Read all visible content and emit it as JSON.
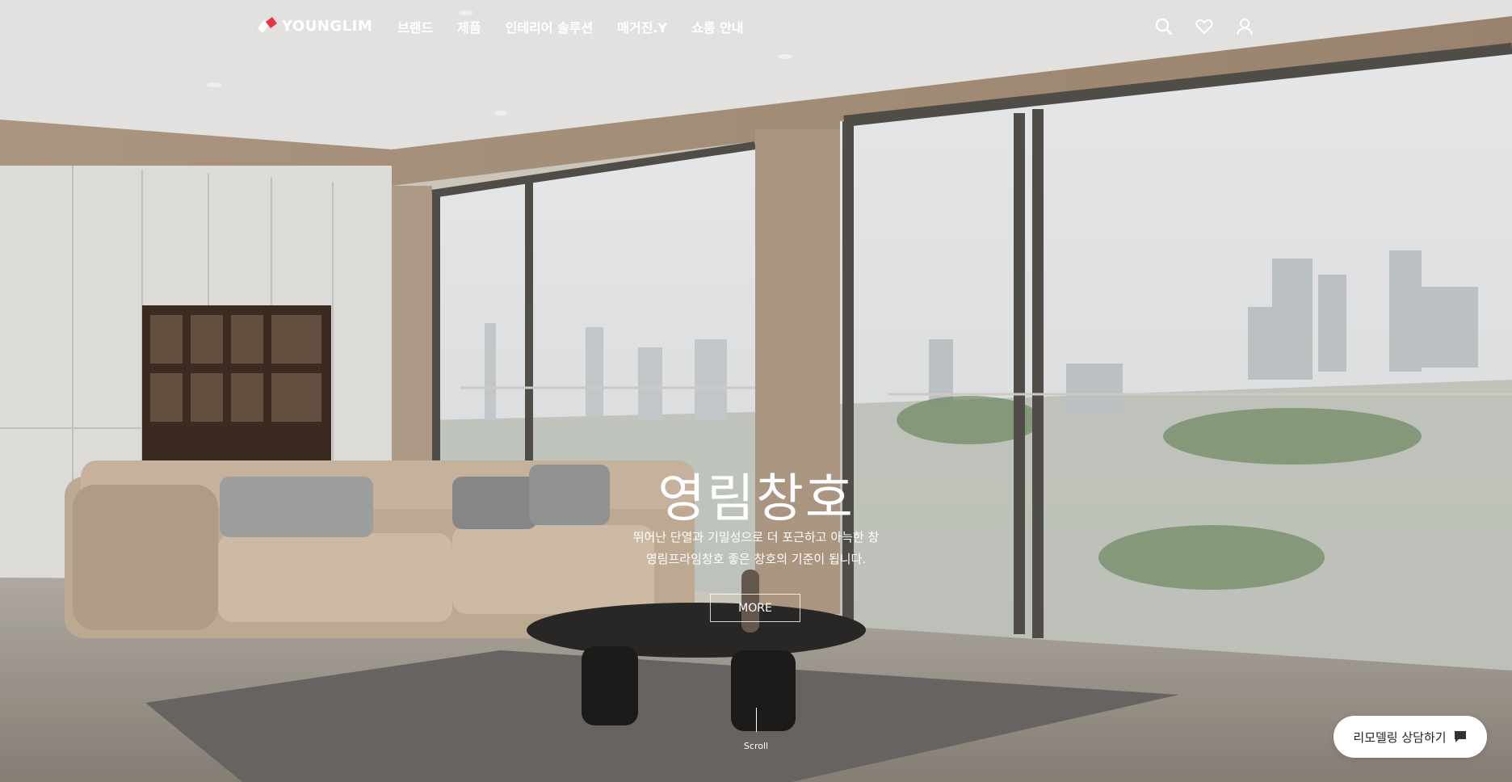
{
  "header": {
    "logo_text": "YOUNGLIM",
    "nav": [
      "브랜드",
      "제품",
      "인테리어 솔루션",
      "매거진.Y",
      "쇼룸 안내"
    ]
  },
  "hero": {
    "title": "영림창호",
    "desc_line1": "뛰어난 단열과 기밀성으로 더 포근하고 아늑한 창",
    "desc_line2": "영림프라임창호 좋은 창호의 기준이 됩니다.",
    "more_label": "MORE",
    "scroll_label": "Scroll"
  },
  "floating": {
    "consult_label": "리모델링 상담하기"
  },
  "icons": {
    "search": "search-icon",
    "wishlist": "heart-icon",
    "account": "user-icon",
    "chat": "chat-bubble-icon"
  },
  "colors": {
    "logo_accent": "#e2363e",
    "text": "#ffffff"
  }
}
